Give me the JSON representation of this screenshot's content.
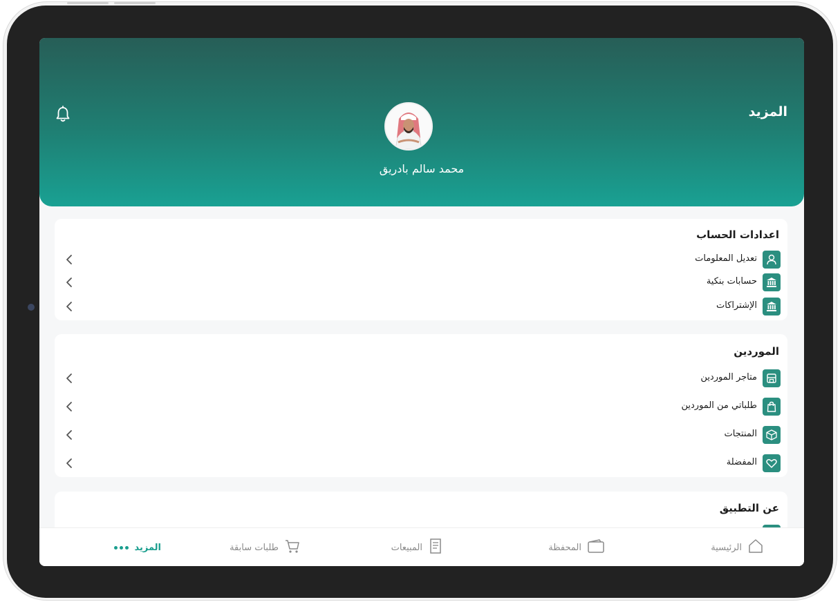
{
  "header": {
    "title": "المزيد",
    "user_name": "محمد سالم بادريق"
  },
  "colors": {
    "brand": "#1f8a7d",
    "accent": "#1a9e8e"
  },
  "sections": {
    "account": {
      "title": "اعدادات الحساب",
      "items": [
        {
          "label": "تعديل المعلومات",
          "icon": "user-icon"
        },
        {
          "label": "حسابات بنكية",
          "icon": "bank-icon"
        },
        {
          "label": "الإشتراكات",
          "icon": "bank-icon"
        }
      ]
    },
    "suppliers": {
      "title": "الموردين",
      "items": [
        {
          "label": "متاجر الموردين",
          "icon": "store-icon"
        },
        {
          "label": "طلباتي من الموردين",
          "icon": "shopping-bag-icon"
        },
        {
          "label": "المنتجات",
          "icon": "box-icon"
        },
        {
          "label": "المفضلة",
          "icon": "heart-icon"
        }
      ]
    },
    "about": {
      "title": "عن التطبيق"
    }
  },
  "bottom_nav": {
    "home": "الرئيسية",
    "wallet": "المحفظة",
    "sales": "المبيعات",
    "previous_orders": "طلبات سابقة",
    "more": "المزيد"
  }
}
